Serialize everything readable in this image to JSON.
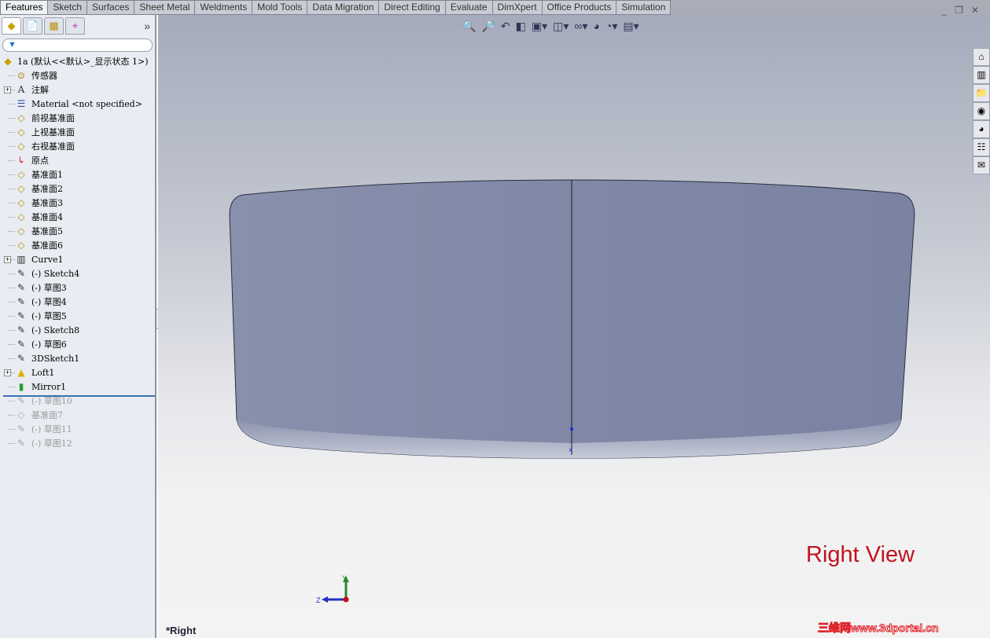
{
  "tabs": [
    "Features",
    "Sketch",
    "Surfaces",
    "Sheet Metal",
    "Weldments",
    "Mold Tools",
    "Data Migration",
    "Direct Editing",
    "Evaluate",
    "DimXpert",
    "Office Products",
    "Simulation"
  ],
  "active_tab": "Features",
  "panel": {
    "more_label": "»",
    "filter_icon": "filter-icon"
  },
  "tree": [
    {
      "label": "1a  (默认<<默认>_显示状态 1>)",
      "icon": "part-icon",
      "root": true
    },
    {
      "label": "传感器",
      "icon": "sensor-icon"
    },
    {
      "label": "注解",
      "icon": "annotation-icon",
      "expand": true
    },
    {
      "label": "Material <not specified>",
      "icon": "material-icon"
    },
    {
      "label": "前视基准面",
      "icon": "plane-icon"
    },
    {
      "label": "上视基准面",
      "icon": "plane-icon"
    },
    {
      "label": "右视基准面",
      "icon": "plane-icon"
    },
    {
      "label": "原点",
      "icon": "origin-icon"
    },
    {
      "label": "基准面1",
      "icon": "plane-icon"
    },
    {
      "label": "基准面2",
      "icon": "plane-icon"
    },
    {
      "label": "基准面3",
      "icon": "plane-icon"
    },
    {
      "label": "基准面4",
      "icon": "plane-icon"
    },
    {
      "label": "基准面5",
      "icon": "plane-icon"
    },
    {
      "label": "基准面6",
      "icon": "plane-icon"
    },
    {
      "label": "Curve1",
      "icon": "curve-icon",
      "expand": true
    },
    {
      "label": "(-) Sketch4",
      "icon": "sketch-icon"
    },
    {
      "label": "(-) 草图3",
      "icon": "sketch-icon"
    },
    {
      "label": "(-) 草图4",
      "icon": "sketch-icon"
    },
    {
      "label": "(-) 草图5",
      "icon": "sketch-icon"
    },
    {
      "label": "(-) Sketch8",
      "icon": "sketch-icon"
    },
    {
      "label": "(-) 草图6",
      "icon": "sketch-icon"
    },
    {
      "label": "3DSketch1",
      "icon": "3dsketch-icon"
    },
    {
      "label": "Loft1",
      "icon": "loft-icon",
      "expand": true
    },
    {
      "label": "Mirror1",
      "icon": "mirror-icon"
    },
    {
      "label": "(-) 草图10",
      "icon": "sketch-icon",
      "suppressed": true
    },
    {
      "label": "基准面7",
      "icon": "plane-icon",
      "suppressed": true
    },
    {
      "label": "(-) 草图11",
      "icon": "sketch-icon",
      "suppressed": true
    },
    {
      "label": "(-) 草图12",
      "icon": "sketch-icon",
      "suppressed": true
    }
  ],
  "view_toolbar": [
    "zoom-to-fit-icon",
    "zoom-to-area-icon",
    "previous-view-icon",
    "section-view-icon",
    "view-orientation-icon",
    "display-style-icon",
    "hide-show-icon",
    "edit-appearance-icon",
    "apply-scene-icon",
    "view-settings-icon"
  ],
  "task_pane": [
    "home-icon",
    "design-library-icon",
    "file-explorer-icon",
    "view-palette-icon",
    "appearances-icon",
    "custom-properties-icon",
    "recent-icon"
  ],
  "viewport": {
    "annotation": "Right View",
    "view_name": "*Right",
    "triad_y": "Y",
    "triad_z": "Z",
    "watermark": "三维网www.3dportal.cn",
    "annotation_color": "#c0141e",
    "model_color": "#8088a6"
  }
}
